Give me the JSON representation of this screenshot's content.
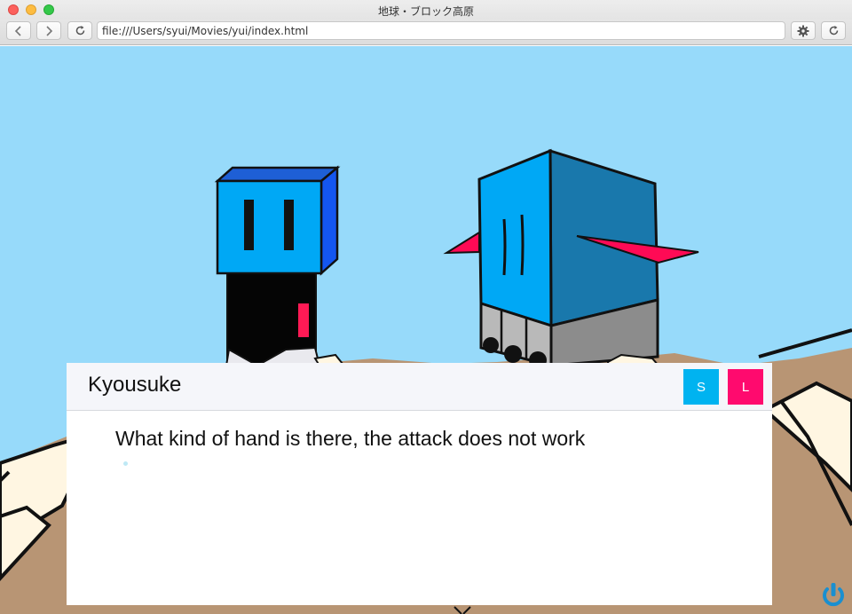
{
  "window": {
    "title": "地球・ブロック高原",
    "url": "file:///Users/syui/Movies/yui/index.html"
  },
  "toolbar": {
    "back_icon": "chevron-left-icon",
    "forward_icon": "chevron-right-icon",
    "reload_icon": "reload-icon",
    "settings_icon": "gear-icon"
  },
  "dialog": {
    "speaker": "Kyousuke",
    "message": "What kind of hand is there, the attack does not work",
    "save_label": "S",
    "load_label": "L"
  },
  "colors": {
    "sky": "#97dafa",
    "save_button": "#00b3f0",
    "load_button": "#ff0a6e",
    "character_blue": "#00a8f5",
    "ground": "#b89574"
  }
}
